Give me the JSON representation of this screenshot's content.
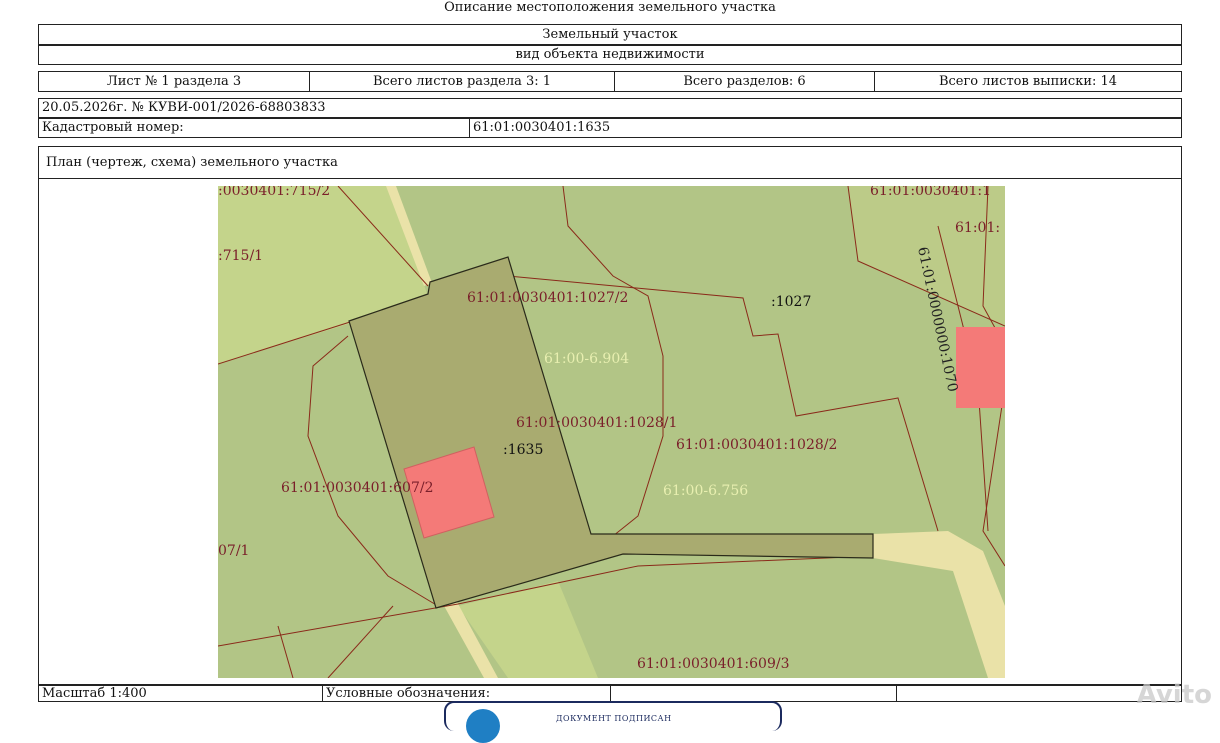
{
  "page_title": "Описание местоположения земельного участка",
  "object_type": "Земельный участок",
  "object_kind_caption": "вид объекта недвижимости",
  "sheet_info": {
    "sheet": "Лист № 1 раздела 3",
    "sheets_in_section": "Всего листов раздела 3: 1",
    "total_sections": "Всего разделов: 6",
    "total_sheets": "Всего листов выписки: 14"
  },
  "extract_ref": "20.05.2026г. № КУВИ-001/2026-68803833",
  "cadastral": {
    "label": "Кадастровый номер:",
    "value": "61:01:0030401:1635"
  },
  "plan_title": "План (чертеж, схема) земельного участка",
  "map_labels": {
    "p715_2": ":0030401:715/2",
    "p715_1": ":715/1",
    "p1027_2": "61:01:0030401:1027/2",
    "p1027": ":1027",
    "z6904": "61:00-6.904",
    "p1028_1": "61:01:0030401:1028/1",
    "p1028_2": "61:01:0030401:1028/2",
    "p1635": ":1635",
    "p607_2": "61:01:0030401:607/2",
    "z6756": "61:00-6.756",
    "p07_1": "07/1",
    "p609_3": "61:01:0030401:609/3",
    "top_right": "61:01:0030401:1",
    "top_right2": "61:01:",
    "road": "61:01:0000000:1070"
  },
  "colors": {
    "map_bg": "#b2c586",
    "light_parcel": "#c4d48b",
    "selected_parcel": "#a9ab70",
    "building": "#f47a78",
    "road": "#eae2a8",
    "boundary": "#8a2a1a",
    "zone_label": "#e8efb0"
  },
  "footer": {
    "scale": "Масштаб 1:400",
    "legend": "Условные обозначения:"
  },
  "stamp_text": "ДОКУМЕНТ ПОДПИСАН",
  "watermark": "Avito"
}
